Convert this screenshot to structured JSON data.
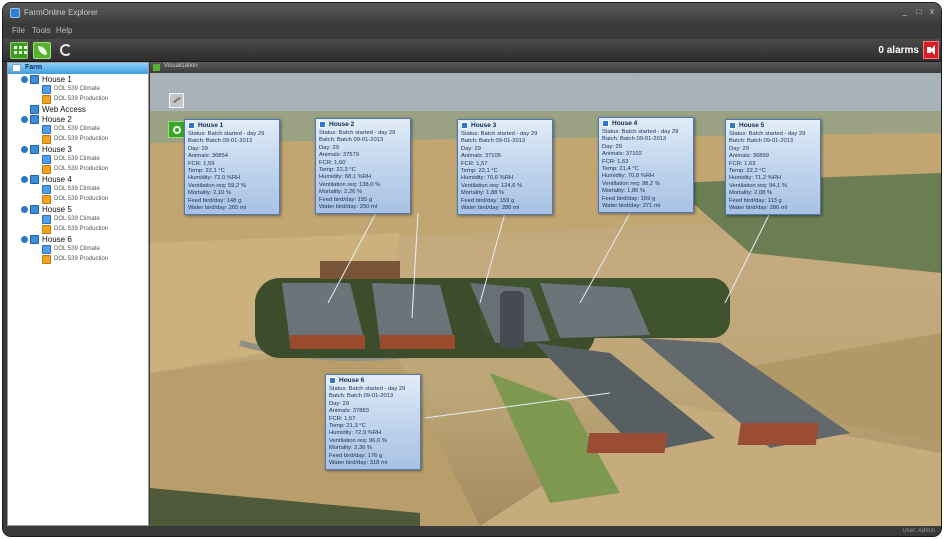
{
  "window": {
    "title": "FarmOnline Explorer",
    "minimize": "_",
    "maximize": "□",
    "close": "x"
  },
  "menu": [
    "File",
    "Tools",
    "Help"
  ],
  "toolbar": {
    "alarms_label": "0 alarms"
  },
  "tree": {
    "root_label": "Farm",
    "items": [
      {
        "label": "House 1",
        "children": [
          {
            "label": "DOL 539 Climate",
            "icon": "climate-icon"
          },
          {
            "label": "DOL 539 Production",
            "icon": "production-icon"
          }
        ]
      },
      {
        "label": "Web Access",
        "children": []
      },
      {
        "label": "House 2",
        "children": [
          {
            "label": "DOL 539 Climate",
            "icon": "climate-icon"
          },
          {
            "label": "DOL 539 Production",
            "icon": "production-icon"
          }
        ]
      },
      {
        "label": "House 3",
        "children": [
          {
            "label": "DOL 539 Climate",
            "icon": "climate-icon"
          },
          {
            "label": "DOL 539 Production",
            "icon": "production-icon"
          }
        ]
      },
      {
        "label": "House 4",
        "children": [
          {
            "label": "DOL 539 Climate",
            "icon": "climate-icon"
          },
          {
            "label": "DOL 539 Production",
            "icon": "production-icon"
          }
        ]
      },
      {
        "label": "House 5",
        "children": [
          {
            "label": "DOL 539 Climate",
            "icon": "climate-icon"
          },
          {
            "label": "DOL 539 Production",
            "icon": "production-icon"
          }
        ]
      },
      {
        "label": "House 6",
        "children": [
          {
            "label": "DOL 539 Climate",
            "icon": "climate-icon"
          },
          {
            "label": "DOL 539 Production",
            "icon": "production-icon"
          }
        ]
      }
    ]
  },
  "main": {
    "panel_title": "Visualization"
  },
  "cards": {
    "house1": {
      "title": "House 1",
      "lines": [
        "Status: Batch started - day 29",
        "Batch: Batch 09-01-2013",
        "Day: 29",
        "Animals: 36854",
        "FCR: 1,59",
        "Temp: 22,1 °C",
        "Humidity: 72,0 %RH",
        "Ventilation req: 59,2 %",
        "Mortality: 2,10 %",
        "Feed bird/day: 148 g",
        "Water bird/day: 265 ml"
      ]
    },
    "house2": {
      "title": "House 2",
      "lines": [
        "Status: Batch started - day 29",
        "Batch: Batch 09-01-2013",
        "Day: 29",
        "Animals: 37579",
        "FCR: 1,60",
        "Temp: 22,3 °C",
        "Humidity: 68,1 %RH",
        "Ventilation req: 138,0 %",
        "Mortality: 2,26 %",
        "Feed bird/day: 155 g",
        "Water bird/day: 250 ml"
      ]
    },
    "house3": {
      "title": "House 3",
      "lines": [
        "Status: Batch started - day 29",
        "Batch: Batch 09-01-2013",
        "Day: 29",
        "Animals: 37105",
        "FCR: 1,57",
        "Temp: 22,1 °C",
        "Humidity: 70,6 %RH",
        "Ventilation req: 124,6 %",
        "Mortality: 1,88 %",
        "Feed bird/day: 159 g",
        "Water bird/day: 288 ml"
      ]
    },
    "house4": {
      "title": "House 4",
      "lines": [
        "Status: Batch started - day 29",
        "Batch: Batch 09-01-2013",
        "Day: 29",
        "Animals: 37102",
        "FCR: 1,63",
        "Temp: 21,4 °C",
        "Humidity: 70,8 %RH",
        "Ventilation req: 98,2 %",
        "Mortality: 1,86 %",
        "Feed bird/day: 159 g",
        "Water bird/day: 271 ml"
      ]
    },
    "house5": {
      "title": "House 5",
      "lines": [
        "Status: Batch started - day 29",
        "Batch: Batch 09-01-2013",
        "Day: 29",
        "Animals: 36899",
        "FCR: 1,63",
        "Temp: 22,2 °C",
        "Humidity: 71,2 %RH",
        "Ventilation req: 94,1 %",
        "Mortality: 2,08 %",
        "Feed bird/day: 113 g",
        "Water bird/day: 286 ml"
      ]
    },
    "house6": {
      "title": "House 6",
      "lines": [
        "Status: Batch started - day 29",
        "Batch: Batch 09-01-2013",
        "Day: 29",
        "Animals: 37883",
        "FCR: 1,67",
        "Temp: 21,3 °C",
        "Humidity: 72,9 %RH",
        "Ventilation req: 96,6 %",
        "Mortality: 2,36 %",
        "Feed bird/day: 176 g",
        "Water bird/day: 318 ml"
      ]
    }
  },
  "status": {
    "user": "User: Admin"
  },
  "colors": {
    "alarm": "#d51f24",
    "tree_header": "#3f9ddc",
    "card_border": "#4f79b8"
  }
}
